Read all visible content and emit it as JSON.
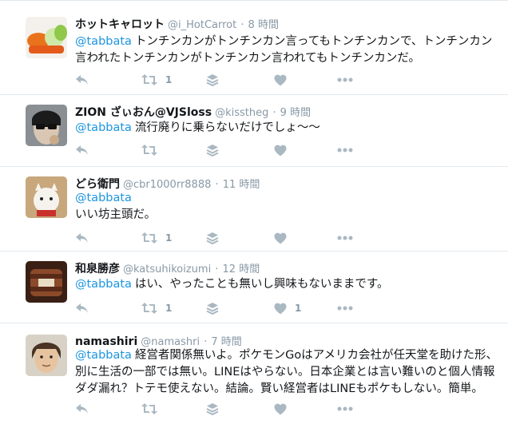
{
  "colors": {
    "link": "#1b95e0",
    "meta": "#8899a6",
    "icon": "#aab8c2",
    "text": "#14171a",
    "divider": "#e1e8ed"
  },
  "icons": [
    "reply-icon",
    "retweet-icon",
    "stack-icon",
    "heart-icon",
    "more-icon"
  ],
  "tweets": [
    {
      "name": "ホットキャロット",
      "handle": "@i_HotCarrot",
      "dot": "·",
      "time": "8 時間",
      "mention": "@tabbata",
      "text": "トンチンカンがトンチンカン言ってもトンチンカンで、トンチンカン言われたトンチンカンがトンチンカン言われてもトンチンカンだ。",
      "retweets": "1",
      "likes": ""
    },
    {
      "name": "ZION ざぃおん@VJSloss",
      "handle": "@kisstheg",
      "dot": "·",
      "time": "9 時間",
      "mention": "@tabbata",
      "text": "流行廃りに乗らないだけでしょ〜〜",
      "retweets": "",
      "likes": ""
    },
    {
      "name": "どら衛門",
      "handle": "@cbr1000rr8888",
      "dot": "·",
      "time": "11 時間",
      "mention": "@tabbata",
      "text": "いい坊主頭だ。",
      "retweets": "1",
      "likes": ""
    },
    {
      "name": "和泉勝彦",
      "handle": "@katsuhikoizumi",
      "dot": "·",
      "time": "12 時間",
      "mention": "@tabbata",
      "text": "はい、やったことも無いし興味もないままです。",
      "retweets": "1",
      "likes": "1"
    },
    {
      "name": "namashiri",
      "handle": "@namashri",
      "dot": "·",
      "time": "7 時間",
      "mention": "@tabbata",
      "text": "経営者関係無いよ。ポケモンGoはアメリカ会社が任天堂を助けた形、別に生活の一部では無い。LINEはやらない。日本企業とは言い難いのと個人情報ダダ漏れ？トテモ使えない。結論。賢い経営者はLINEもポケもしない。簡単。",
      "retweets": "",
      "likes": ""
    }
  ]
}
